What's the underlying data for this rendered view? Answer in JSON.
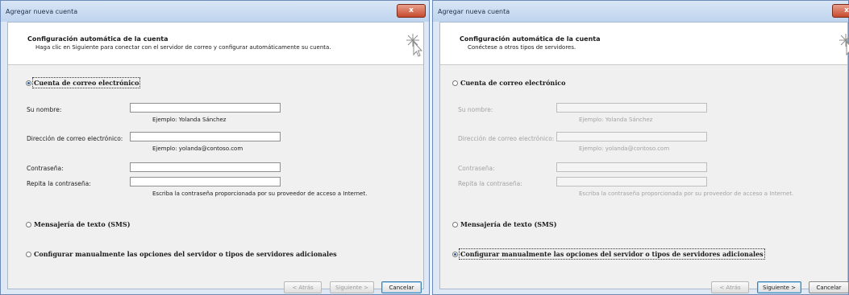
{
  "left_window": {
    "title": "Agregar nueva cuenta",
    "close_glyph": "x",
    "header_title": "Configuración automática de la cuenta",
    "header_subtitle": "Haga clic en Siguiente para conectar con el servidor de correo y configurar automáticamente su cuenta.",
    "radio_email": "Cuenta de correo electrónico",
    "label_name": "Su nombre:",
    "hint_name": "Ejemplo: Yolanda Sánchez",
    "label_email": "Dirección de correo electrónico:",
    "hint_email": "Ejemplo: yolanda@contoso.com",
    "label_password": "Contraseña:",
    "label_repeat": "Repita la contraseña:",
    "hint_password": "Escriba la contraseña proporcionada por su proveedor de acceso a Internet.",
    "radio_sms": "Mensajería de texto (SMS)",
    "radio_manual": "Configurar manualmente las opciones del servidor o tipos de servidores adicionales",
    "selected_option": "email",
    "btn_back": "< Atrás",
    "btn_next": "Siguiente >",
    "btn_cancel": "Cancelar"
  },
  "right_window": {
    "title": "Agregar nueva cuenta",
    "close_glyph": "x",
    "header_title": "Configuración automática de la cuenta",
    "header_subtitle": "Conéctese a otros tipos de servidores.",
    "radio_email": "Cuenta de correo electrónico",
    "label_name": "Su nombre:",
    "hint_name": "Ejemplo: Yolanda Sánchez",
    "label_email": "Dirección de correo electrónico:",
    "hint_email": "Ejemplo: yolanda@contoso.com",
    "label_password": "Contraseña:",
    "label_repeat": "Repita la contraseña:",
    "hint_password": "Escriba la contraseña proporcionada por su proveedor de acceso a Internet.",
    "radio_sms": "Mensajería de texto (SMS)",
    "radio_manual": "Configurar manualmente las opciones del servidor o tipos de servidores adicionales",
    "selected_option": "manual",
    "btn_back": "< Atrás",
    "btn_next": "Siguiente >",
    "btn_cancel": "Cancelar"
  },
  "icons": {
    "wizard": "sparkle-cursor-icon"
  },
  "colors": {
    "title_bar": "#bfd4ee",
    "close_button": "#c64a2e",
    "selected_radio": "#2c5e9c",
    "default_button_border": "#3c7fb1"
  }
}
